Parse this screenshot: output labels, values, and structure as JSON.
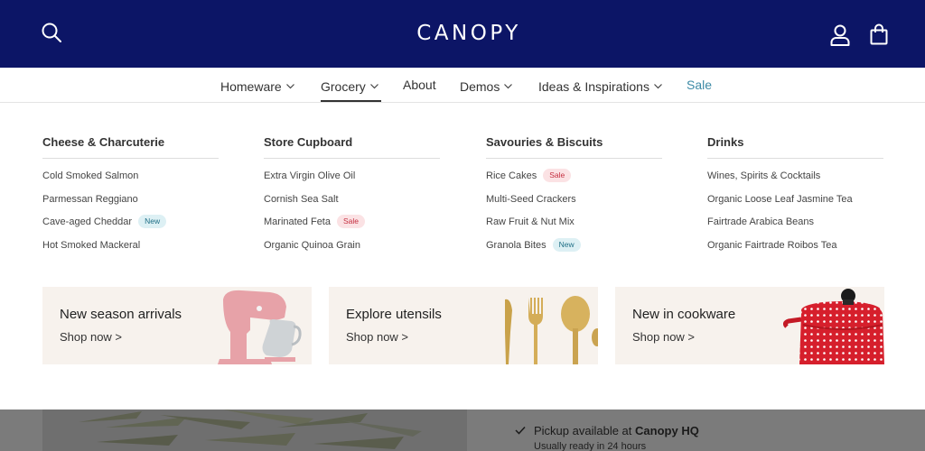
{
  "brand": {
    "logo_text": "CANOPY"
  },
  "header": {
    "icons": {
      "search": "search-icon",
      "account": "user-icon",
      "cart": "bag-icon"
    },
    "background": "#0c1566"
  },
  "nav": {
    "items": [
      {
        "label": "Homeware",
        "has_dropdown": true
      },
      {
        "label": "Grocery",
        "has_dropdown": true,
        "active": true
      },
      {
        "label": "About",
        "has_dropdown": false
      },
      {
        "label": "Demos",
        "has_dropdown": true
      },
      {
        "label": "Ideas & Inspirations",
        "has_dropdown": true
      },
      {
        "label": "Sale",
        "has_dropdown": false,
        "color": "#3d8aa6"
      }
    ]
  },
  "mega_menu": {
    "columns": [
      {
        "title": "Cheese & Charcuterie",
        "items": [
          {
            "label": "Cold Smoked Salmon"
          },
          {
            "label": "Parmessan Reggiano"
          },
          {
            "label": "Cave-aged Cheddar",
            "badge": "New"
          },
          {
            "label": "Hot Smoked Mackeral"
          }
        ]
      },
      {
        "title": "Store Cupboard",
        "items": [
          {
            "label": "Extra Virgin Olive Oil"
          },
          {
            "label": "Cornish Sea Salt"
          },
          {
            "label": "Marinated Feta",
            "badge": "Sale"
          },
          {
            "label": "Organic Quinoa Grain"
          }
        ]
      },
      {
        "title": "Savouries & Biscuits",
        "items": [
          {
            "label": "Rice Cakes",
            "badge": "Sale"
          },
          {
            "label": "Multi-Seed Crackers"
          },
          {
            "label": "Raw Fruit & Nut Mix"
          },
          {
            "label": "Granola Bites",
            "badge": "New"
          }
        ]
      },
      {
        "title": "Drinks",
        "items": [
          {
            "label": "Wines, Spirits & Cocktails"
          },
          {
            "label": "Organic Loose Leaf Jasmine Tea"
          },
          {
            "label": "Fairtrade Arabica Beans"
          },
          {
            "label": "Organic Fairtrade Roibos Tea"
          }
        ]
      }
    ],
    "promos": [
      {
        "title": "New season arrivals",
        "link": "Shop now >",
        "image": "stand-mixer-image"
      },
      {
        "title": "Explore utensils",
        "link": "Shop now >",
        "image": "gold-cutlery-image"
      },
      {
        "title": "New in cookware",
        "link": "Shop now >",
        "image": "red-polka-pot-image"
      }
    ]
  },
  "product": {
    "pickup_prefix": "Pickup available at",
    "pickup_location": "Canopy HQ",
    "pickup_note": "Usually ready in 24 hours"
  }
}
